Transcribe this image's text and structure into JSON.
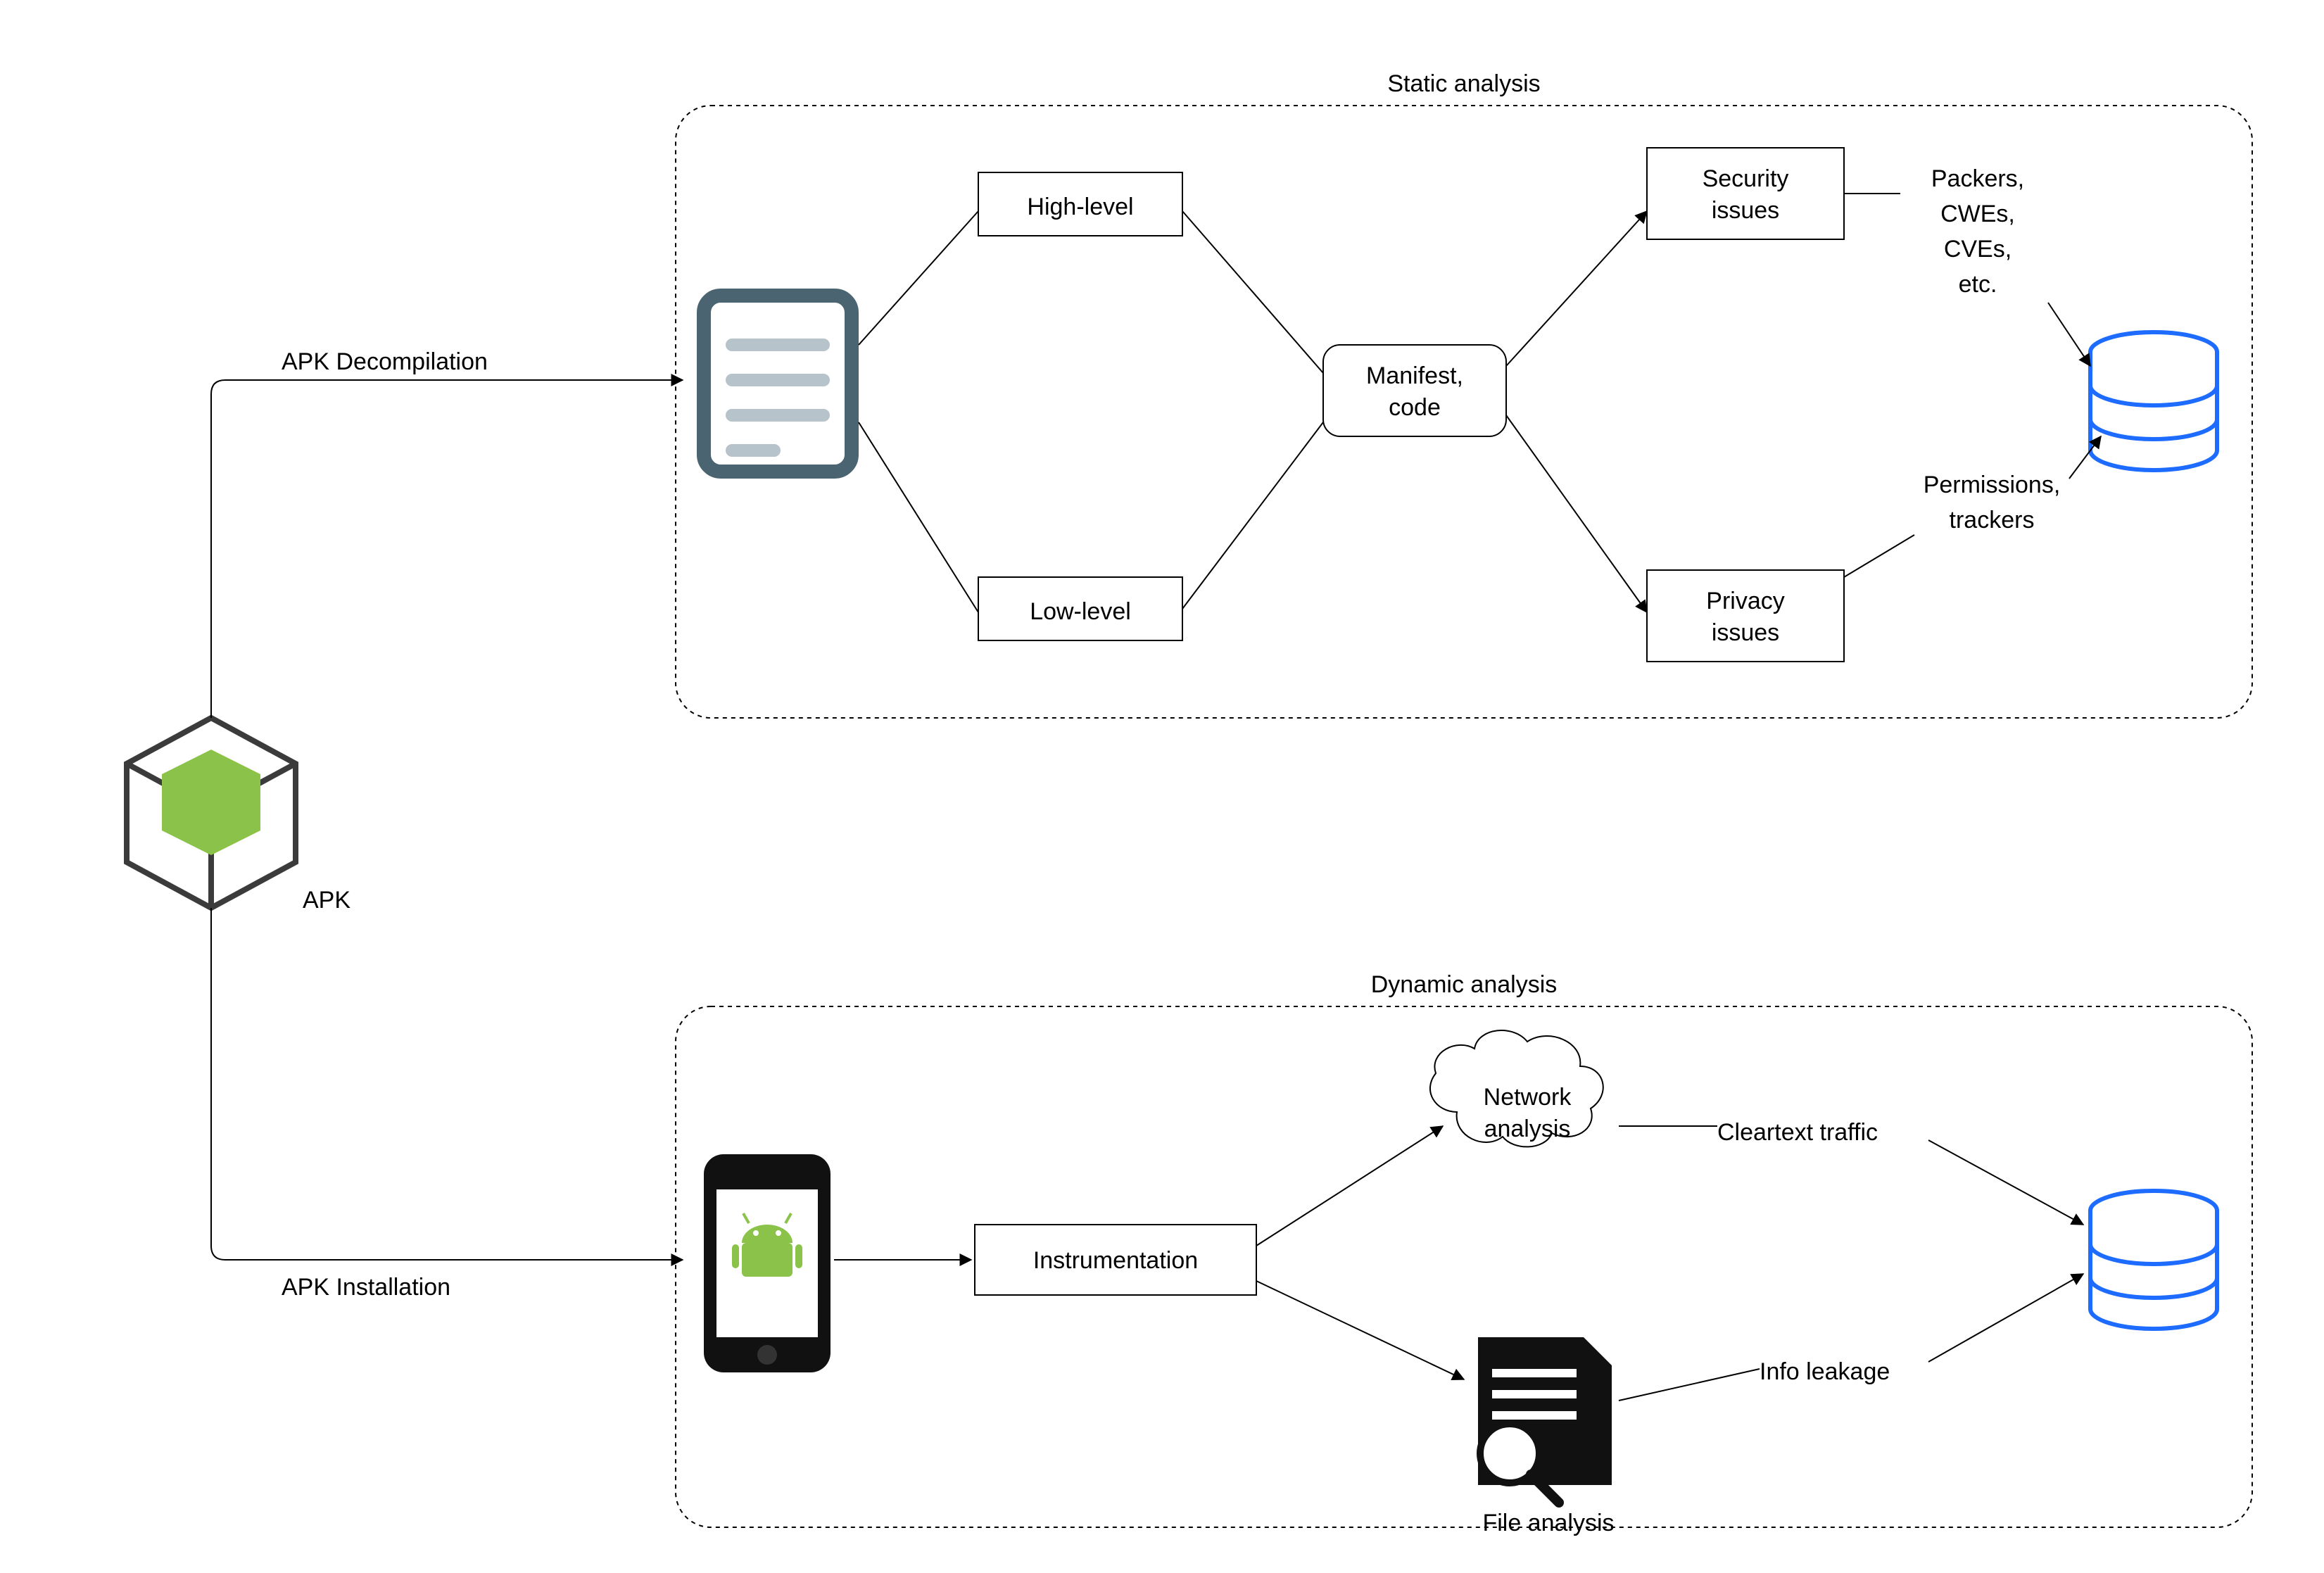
{
  "diagram": {
    "apk_label": "APK",
    "edge_decompilation": "APK Decompilation",
    "edge_installation": "APK Installation",
    "static": {
      "title": "Static analysis",
      "high_level": "High-level",
      "low_level": "Low-level",
      "manifest_line1": "Manifest,",
      "manifest_line2": "code",
      "security_line1": "Security",
      "security_line2": "issues",
      "privacy_line1": "Privacy",
      "privacy_line2": "issues",
      "note_sec1": "Packers,",
      "note_sec2": "CWEs,",
      "note_sec3": "CVEs,",
      "note_sec4": "etc.",
      "note_priv1": "Permissions,",
      "note_priv2": "trackers"
    },
    "dynamic": {
      "title": "Dynamic analysis",
      "instrumentation": "Instrumentation",
      "network_line1": "Network",
      "network_line2": "analysis",
      "file_analysis": "File analysis",
      "cleartext": "Cleartext traffic",
      "leakage": "Info leakage"
    }
  }
}
